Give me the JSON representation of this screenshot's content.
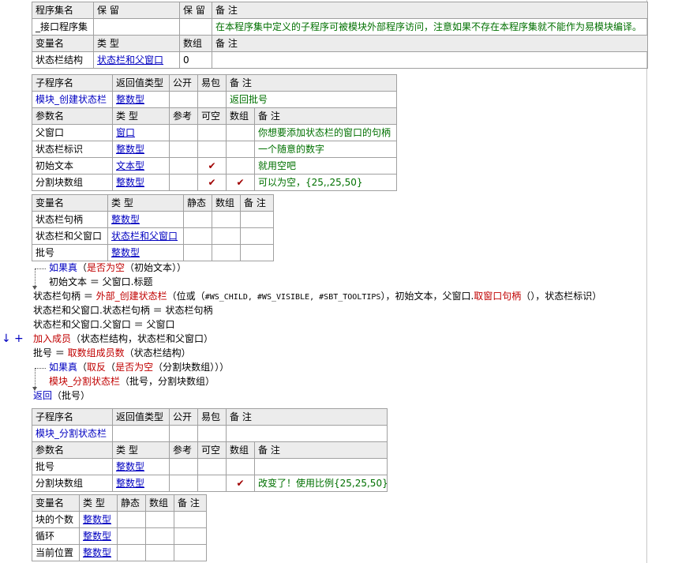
{
  "assembly": {
    "headers": [
      "程序集名",
      "保 留",
      "保 留",
      "备 注"
    ],
    "name": "_接口程序集",
    "note": "在本程序集中定义的子程序可被模块外部程序访问，注意如果不存在本程序集就不能作为易模块编译。",
    "var_headers": [
      "变量名",
      "类 型",
      "数组",
      "备 注"
    ],
    "var": {
      "name": "状态栏结构",
      "type": "状态栏和父窗口",
      "array": "0"
    }
  },
  "sub1": {
    "headers": [
      "子程序名",
      "返回值类型",
      "公开",
      "易包",
      "备 注"
    ],
    "name": "模块_创建状态栏",
    "return_type": "整数型",
    "note": "返回批号",
    "param_headers": [
      "参数名",
      "类 型",
      "参考",
      "可空",
      "数组",
      "备 注"
    ],
    "params": [
      {
        "name": "父窗口",
        "type": "窗口",
        "ref": "",
        "nullable": "",
        "array": "",
        "note": "你想要添加状态栏的窗口的句柄"
      },
      {
        "name": "状态栏标识",
        "type": "整数型",
        "ref": "",
        "nullable": "",
        "array": "",
        "note": "一个随意的数字"
      },
      {
        "name": "初始文本",
        "type": "文本型",
        "ref": "",
        "nullable": "✔",
        "array": "",
        "note": "就用空吧"
      },
      {
        "name": "分割块数组",
        "type": "整数型",
        "ref": "",
        "nullable": "✔",
        "array": "✔",
        "note": "可以为空，{25,,25,50}"
      }
    ],
    "local_headers": [
      "变量名",
      "类 型",
      "静态",
      "数组",
      "备 注"
    ],
    "locals": [
      {
        "name": "状态栏句柄",
        "type": "整数型"
      },
      {
        "name": "状态栏和父窗口",
        "type": "状态栏和父窗口"
      },
      {
        "name": "批号",
        "type": "整数型"
      }
    ]
  },
  "code": {
    "l1_kw": "如果真",
    "l1_cond_fn": "是否为空",
    "l1_cond_arg": "（初始文本））",
    "l1_open": "（",
    "l2": "初始文本 ＝ 父窗口.标题",
    "l3_var": "状态栏句柄 ＝ ",
    "l3_fn": "外部_创建状态栏",
    "l3_p1": "（位或（",
    "l3_consts": "#WS_CHILD, #WS_VISIBLE, #SBT_TOOLTIPS",
    "l3_p2": "），初始文本，父窗口.",
    "l3_fn2": "取窗口句柄",
    "l3_p3": "（），状态栏标识）",
    "l4": "状态栏和父窗口.状态栏句柄 ＝ 状态栏句柄",
    "l5": "状态栏和父窗口.父窗口 ＝ 父窗口",
    "l6_fn": "加入成员",
    "l6_args": "（状态栏结构，状态栏和父窗口）",
    "l7_var": "批号 ＝ ",
    "l7_fn": "取数组成员数",
    "l7_args": "（状态栏结构）",
    "l8_kw": "如果真",
    "l8_a": "（",
    "l8_fn1": "取反",
    "l8_b": "（",
    "l8_fn2": "是否为空",
    "l8_c": "（分割块数组）））",
    "l9_fn": "模块_分割状态栏",
    "l9_args": "（批号，分割块数组）",
    "l10_kw": "返回",
    "l10_args": "（批号）",
    "margin_down": "↓",
    "margin_plus": "+"
  },
  "sub2": {
    "headers": [
      "子程序名",
      "返回值类型",
      "公开",
      "易包",
      "备 注"
    ],
    "name": "模块_分割状态栏",
    "param_headers": [
      "参数名",
      "类 型",
      "参考",
      "可空",
      "数组",
      "备 注"
    ],
    "params": [
      {
        "name": "批号",
        "type": "整数型",
        "ref": "",
        "nullable": "",
        "array": "",
        "note": ""
      },
      {
        "name": "分割块数组",
        "type": "整数型",
        "ref": "",
        "nullable": "",
        "array": "✔",
        "note": "改变了！使用比例{25,25,50}"
      }
    ],
    "local_headers": [
      "变量名",
      "类 型",
      "静态",
      "数组",
      "备 注"
    ],
    "locals": [
      {
        "name": "块的个数",
        "type": "整数型"
      },
      {
        "name": "循环",
        "type": "整数型"
      },
      {
        "name": "当前位置",
        "type": "整数型"
      }
    ]
  },
  "colors": {
    "keyword": "#0000c0",
    "function": "#c00000",
    "comment": "#007000",
    "check": "#a00000",
    "header_bg": "#ececec"
  }
}
